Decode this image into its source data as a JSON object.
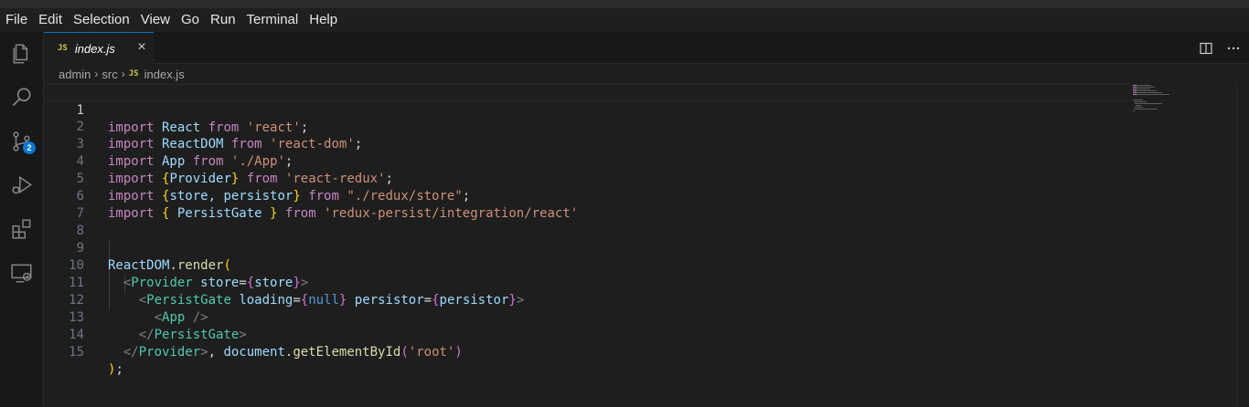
{
  "menu": [
    "File",
    "Edit",
    "Selection",
    "View",
    "Go",
    "Run",
    "Terminal",
    "Help"
  ],
  "activity_bar": {
    "items": [
      {
        "name": "explorer-icon"
      },
      {
        "name": "search-icon"
      },
      {
        "name": "source-control-icon",
        "badge": "2"
      },
      {
        "name": "run-debug-icon"
      },
      {
        "name": "extensions-icon"
      },
      {
        "name": "remote-explorer-icon"
      }
    ]
  },
  "tab": {
    "badge": "JS",
    "title": "index.js",
    "close": "×"
  },
  "breadcrumb": {
    "items": [
      "admin",
      "src"
    ],
    "file_badge": "JS",
    "file": "index.js",
    "separator": "›"
  },
  "editor": {
    "active_line": 1,
    "lines": [
      {
        "n": "1"
      },
      {
        "n": "2"
      },
      {
        "n": "3"
      },
      {
        "n": "4"
      },
      {
        "n": "5"
      },
      {
        "n": "6"
      },
      {
        "n": "7"
      },
      {
        "n": "8"
      },
      {
        "n": "9"
      },
      {
        "n": "10"
      },
      {
        "n": "11"
      },
      {
        "n": "12"
      },
      {
        "n": "13"
      },
      {
        "n": "14"
      },
      {
        "n": "15"
      }
    ],
    "tokens": {
      "l1": [
        "import",
        " React ",
        "from",
        " ",
        "'react'",
        ";"
      ],
      "l2": [
        "import",
        " ReactDOM ",
        "from",
        " ",
        "'react-dom'",
        ";"
      ],
      "l3": [
        "import",
        " App ",
        "from",
        " ",
        "'./App'",
        ";"
      ],
      "l4": [
        "import",
        " ",
        "{",
        "Provider",
        "}",
        " ",
        "from",
        " ",
        "'react-redux'",
        ";"
      ],
      "l5": [
        "import",
        " ",
        "{",
        "store, persistor",
        "}",
        " ",
        "from",
        " ",
        "\"./redux/store\"",
        ";"
      ],
      "l6": [
        "import",
        " ",
        "{",
        " PersistGate ",
        "}",
        " ",
        "from",
        " ",
        "'redux-persist/integration/react'"
      ],
      "l9": [
        "ReactDOM",
        ".",
        "render",
        "("
      ],
      "l10": [
        "  ",
        "<",
        "Provider",
        " ",
        "store",
        "=",
        "{",
        "store",
        "}",
        ">"
      ],
      "l11": [
        "    ",
        "<",
        "PersistGate",
        " ",
        "loading",
        "=",
        "{",
        "null",
        "}",
        " ",
        "persistor",
        "=",
        "{",
        "persistor",
        "}",
        ">"
      ],
      "l12": [
        "      ",
        "<",
        "App",
        " ",
        "/>"
      ],
      "l13": [
        "    ",
        "</",
        "PersistGate",
        ">"
      ],
      "l14": [
        "  ",
        "</",
        "Provider",
        ">",
        ", ",
        "document",
        ".",
        "getElementById",
        "(",
        "'root'",
        ")"
      ],
      "l15": [
        ")",
        ";"
      ]
    }
  },
  "colors": {
    "accent": "#0078d4",
    "keyword": "#c586c0",
    "string": "#ce9178",
    "bracket": "#ffd700",
    "tag": "#4ec9b0"
  }
}
